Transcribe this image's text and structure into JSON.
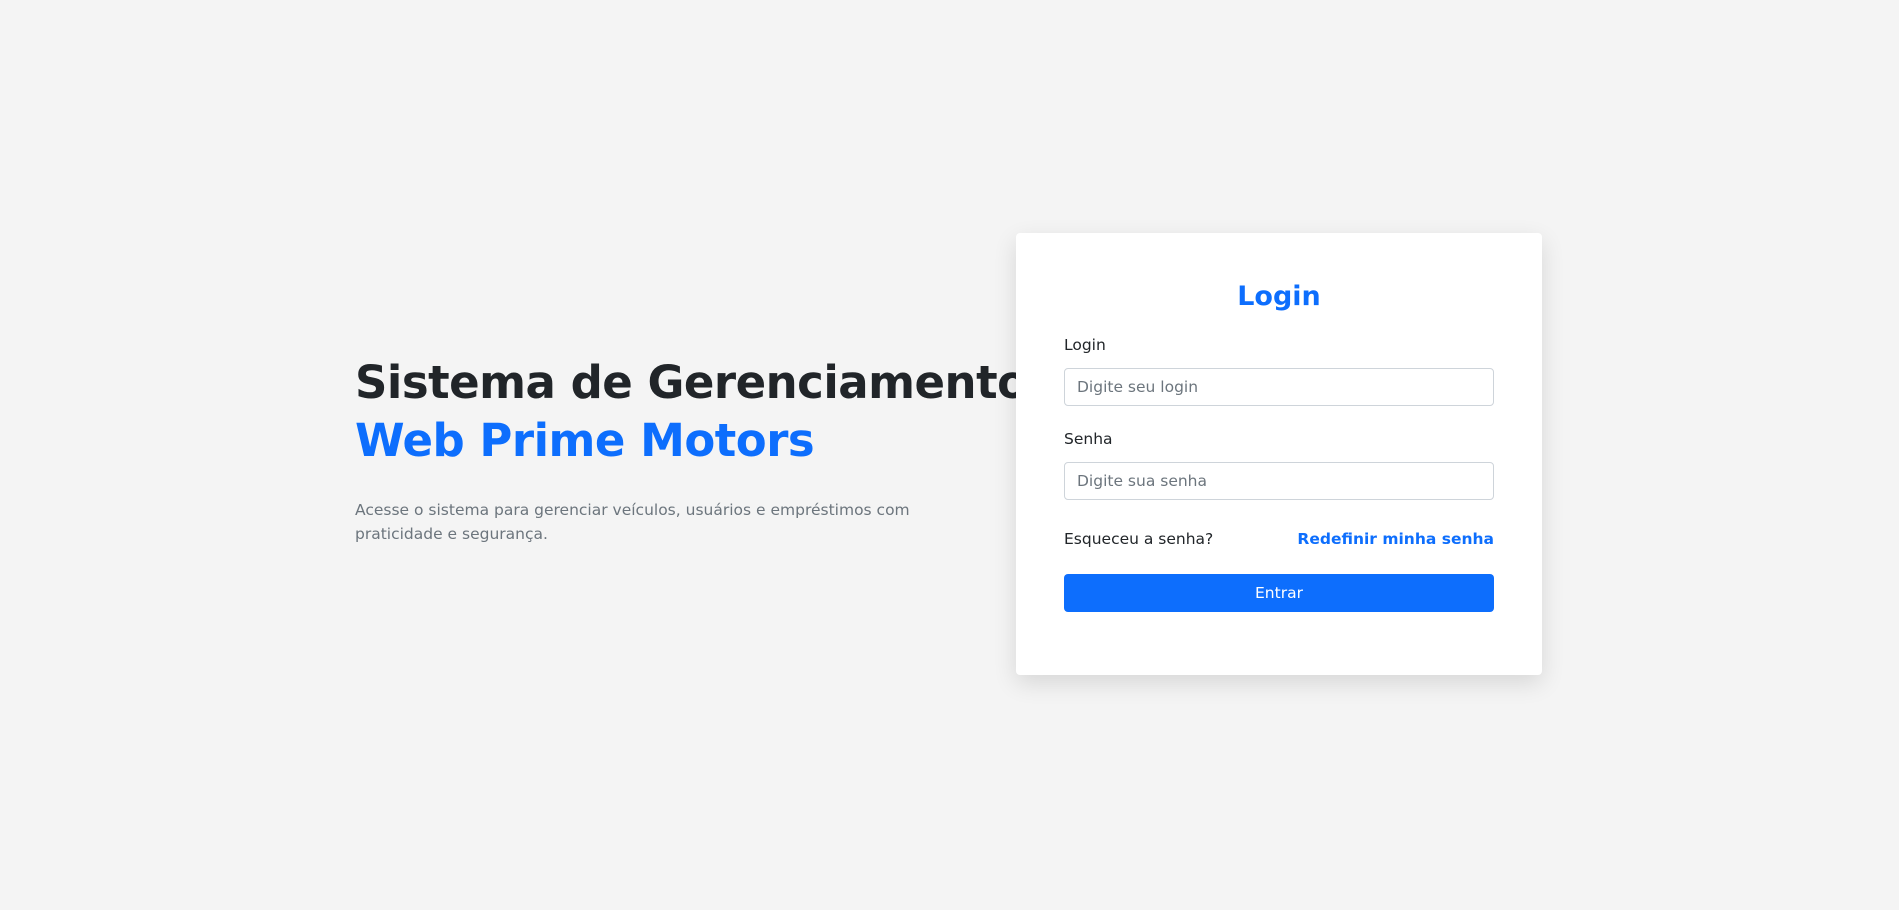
{
  "hero": {
    "title_line1": "Sistema de Gerenciamento",
    "title_line2": "Web Prime Motors",
    "description": "Acesse o sistema para gerenciar veículos, usuários e empréstimos com praticidade e segurança."
  },
  "login_card": {
    "title": "Login",
    "login_field": {
      "label": "Login",
      "placeholder": "Digite seu login",
      "value": ""
    },
    "password_field": {
      "label": "Senha",
      "placeholder": "Digite sua senha",
      "value": ""
    },
    "forgot_text": "Esqueceu a senha?",
    "reset_link": "Redefinir minha senha",
    "submit_label": "Entrar"
  },
  "colors": {
    "accent": "#0d6efd",
    "heading": "#212529",
    "muted": "#6c757d",
    "background": "#f4f4f4",
    "card": "#ffffff"
  }
}
